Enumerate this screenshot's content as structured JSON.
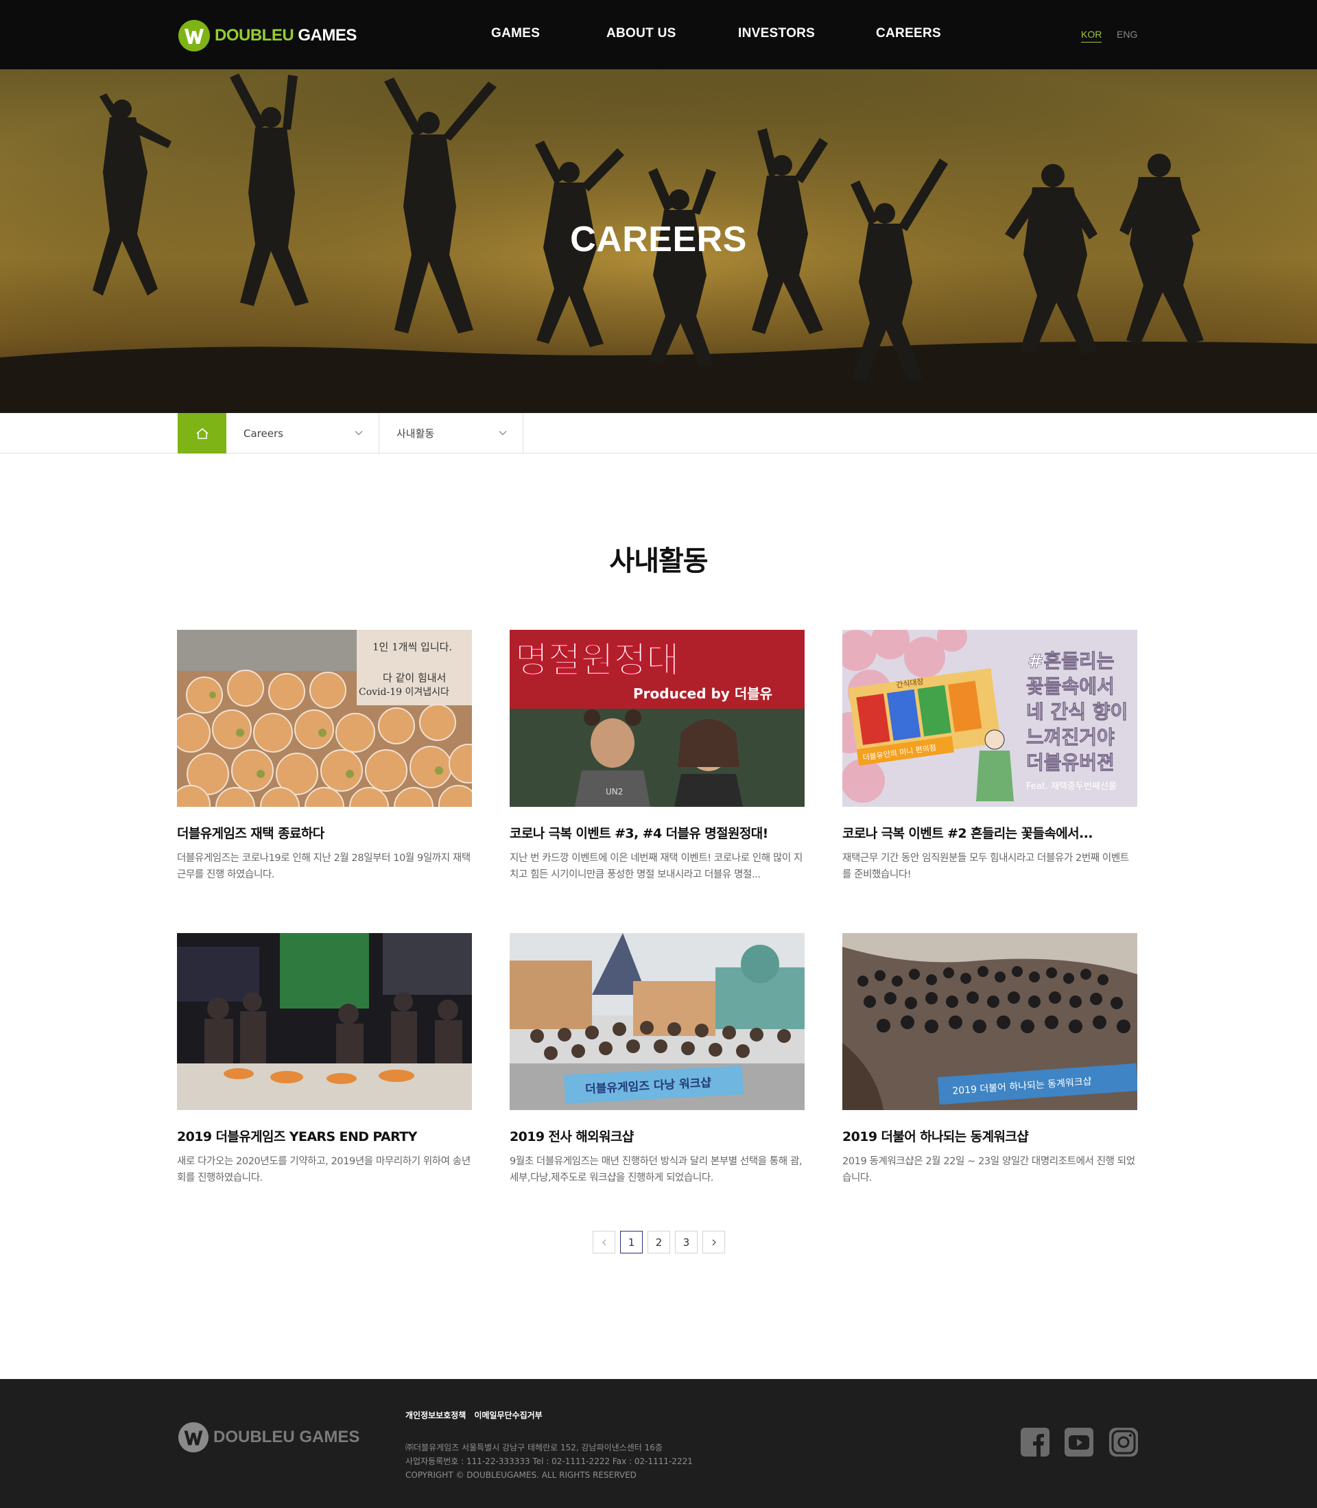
{
  "header": {
    "logo_word1": "DOUBLEU",
    "logo_word2": " GAMES",
    "nav": [
      {
        "label": "GAMES"
      },
      {
        "label": "ABOUT US"
      },
      {
        "label": "INVESTORS"
      },
      {
        "label": "CAREERS"
      }
    ],
    "lang": [
      {
        "label": "KOR",
        "active": true
      },
      {
        "label": "ENG",
        "active": false
      }
    ]
  },
  "hero": {
    "title": "CAREERS"
  },
  "breadcrumb": {
    "home_icon": "home-icon",
    "level1": "Careers",
    "level2": "사내활동"
  },
  "section": {
    "title": "사내활동"
  },
  "posts": [
    {
      "title": "더블유게임즈 재택 종료하다",
      "desc": "더블유게임즈는 코로나19로 인해 지난 2월 28일부터 10월 9일까지 재택 근무를 진행 하였습니다."
    },
    {
      "title": "코로나 극복 이벤트 #3, #4 더블유 명절원정대!",
      "desc": "지난 번 카드깡 이벤트에 이은 네번째 재택 이벤트! 코로나로 인해 많이 지치고 힘든 시기이니만큼 풍성한 명절 보내시라고 더블유 명절..."
    },
    {
      "title": "코로나 극복 이벤트 #2 흔들리는 꽃들속에서...",
      "desc": "재택근무 기간 동안 임직원분들 모두 힘내시라고  더블유가 2번째 이벤트를 준비했습니다!"
    },
    {
      "title": "2019 더블유게임즈 YEARS END PARTY",
      "desc": "새로 다가오는 2020년도를 기약하고, 2019년을 마무리하기 위하여 송년회를 진행하였습니다."
    },
    {
      "title": "2019 전사 해외워크샵",
      "desc": "9월초 더블유게임즈는 매년 진행하던 방식과 달리 본부별 선택을 통해 괌,세부,다낭,제주도로 워크샵을 진행하게 되었습니다."
    },
    {
      "title": "2019 더불어 하나되는 동계워크샵",
      "desc": "2019 동계워크샵은 2월 22일 ~ 23일 양일간 대명리조트에서 진행 되었습니다."
    }
  ],
  "thumb_text": {
    "p1_sign_1": "1인 1개씩 입니다.",
    "p1_sign_2": "다 같이 힘내서",
    "p1_sign_3": "Covid-19 이겨냅시다",
    "p2_banner": "명절원정대",
    "p2_sub": "Produced by 더블유",
    "p2_shirt": "UN2",
    "p3_lines": [
      "#흔들리는",
      "꽃들속에서",
      "네 간식 향이",
      "느껴진거야",
      "더블유버젼"
    ],
    "p3_feat": "Feat. 재택중두번째선물",
    "p3_box_top": "간식대장",
    "p3_box_label": "더블유인의 미니 편의점",
    "p5_banner": "더블유게임즈 다낭 워크샵",
    "p6_banner": "2019 더불어 하나되는 동계워크샵"
  },
  "pagination": {
    "pages": [
      "1",
      "2",
      "3"
    ],
    "current": "1",
    "prev_icon": "chevron-left-icon",
    "next_icon": "chevron-right-icon"
  },
  "footer": {
    "logo_word1": "DOUBLEU",
    "logo_word2": " GAMES",
    "links": [
      "개인정보보호정책",
      "이메일무단수집거부"
    ],
    "info_line1": "㈜더블유게임즈    서울특별시 강남구 테헤란로 152, 강남파이낸스센터 16층",
    "info_line2": "사업자등록번호 : 111-22-333333    Tel : 02-1111-2222    Fax : 02-1111-2221",
    "copyright": "COPYRIGHT © DOUBLEUGAMES. ALL RIGHTS RESERVED",
    "social": [
      "facebook-icon",
      "youtube-icon",
      "instagram-icon"
    ]
  },
  "colors": {
    "brand_green": "#7eb416",
    "header_bg": "#0c0c0c",
    "footer_bg": "#1e1e1e",
    "pager_active": "#2b2f7a"
  }
}
